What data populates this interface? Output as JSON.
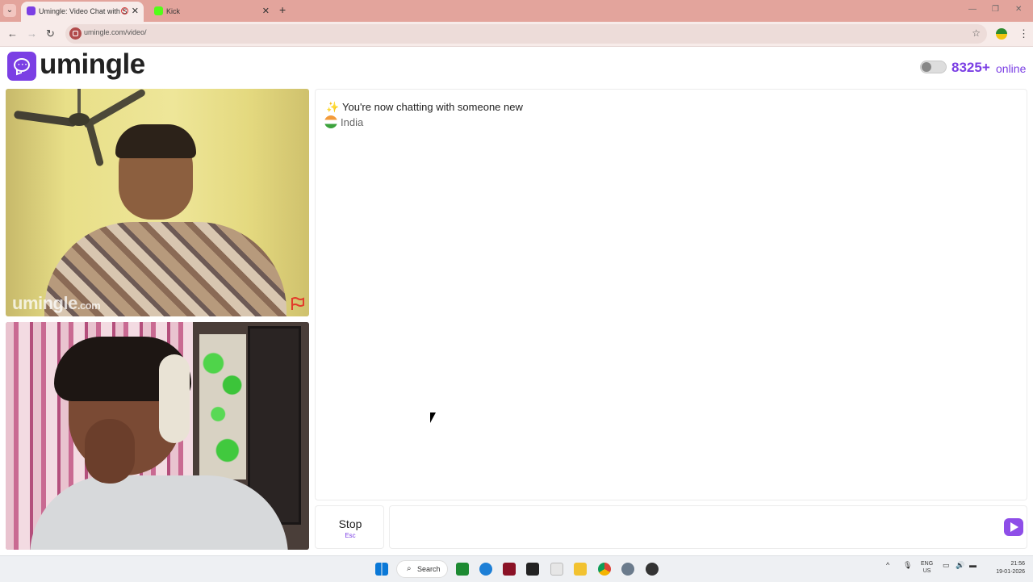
{
  "browser": {
    "tabs": [
      {
        "title": "Umingle: Video Chat with S",
        "active": true
      },
      {
        "title": "Kick",
        "active": false
      }
    ],
    "url": "umingle.com/video/"
  },
  "header": {
    "logo_text": "umingle",
    "online_count": "8325+",
    "online_label": "online"
  },
  "video": {
    "watermark": "umingle",
    "watermark_suffix": ".com"
  },
  "chat": {
    "status_message": "You're now chatting with someone new",
    "country": "India"
  },
  "controls": {
    "stop_label": "Stop",
    "stop_hint": "Esc",
    "message_value": ""
  },
  "taskbar": {
    "search_label": "Search",
    "lang_line1": "ENG",
    "lang_line2": "US",
    "time": "21:56",
    "date": "19-01-2026"
  },
  "colors": {
    "brand": "#7b3fe4",
    "tabbar": "#e3a49c"
  }
}
